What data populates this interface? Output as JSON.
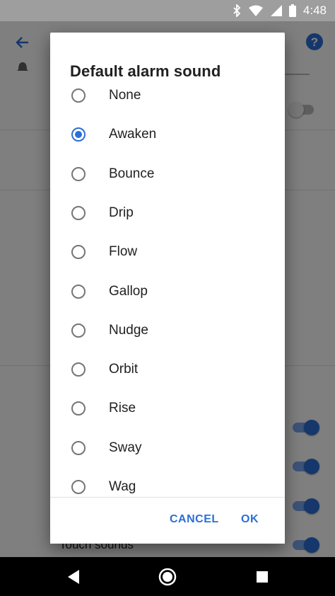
{
  "status_bar": {
    "time": "4:48"
  },
  "background": {
    "touch_sounds_label": "Touch sounds"
  },
  "dialog": {
    "title": "Default alarm sound",
    "options": [
      {
        "label": "None",
        "selected": false
      },
      {
        "label": "Awaken",
        "selected": true
      },
      {
        "label": "Bounce",
        "selected": false
      },
      {
        "label": "Drip",
        "selected": false
      },
      {
        "label": "Flow",
        "selected": false
      },
      {
        "label": "Gallop",
        "selected": false
      },
      {
        "label": "Nudge",
        "selected": false
      },
      {
        "label": "Orbit",
        "selected": false
      },
      {
        "label": "Rise",
        "selected": false
      },
      {
        "label": "Sway",
        "selected": false
      },
      {
        "label": "Wag",
        "selected": false
      }
    ],
    "cancel_label": "CANCEL",
    "ok_label": "OK"
  },
  "colors": {
    "accent": "#2b6fd6",
    "scrim": "rgba(0,0,0,0.5)"
  }
}
